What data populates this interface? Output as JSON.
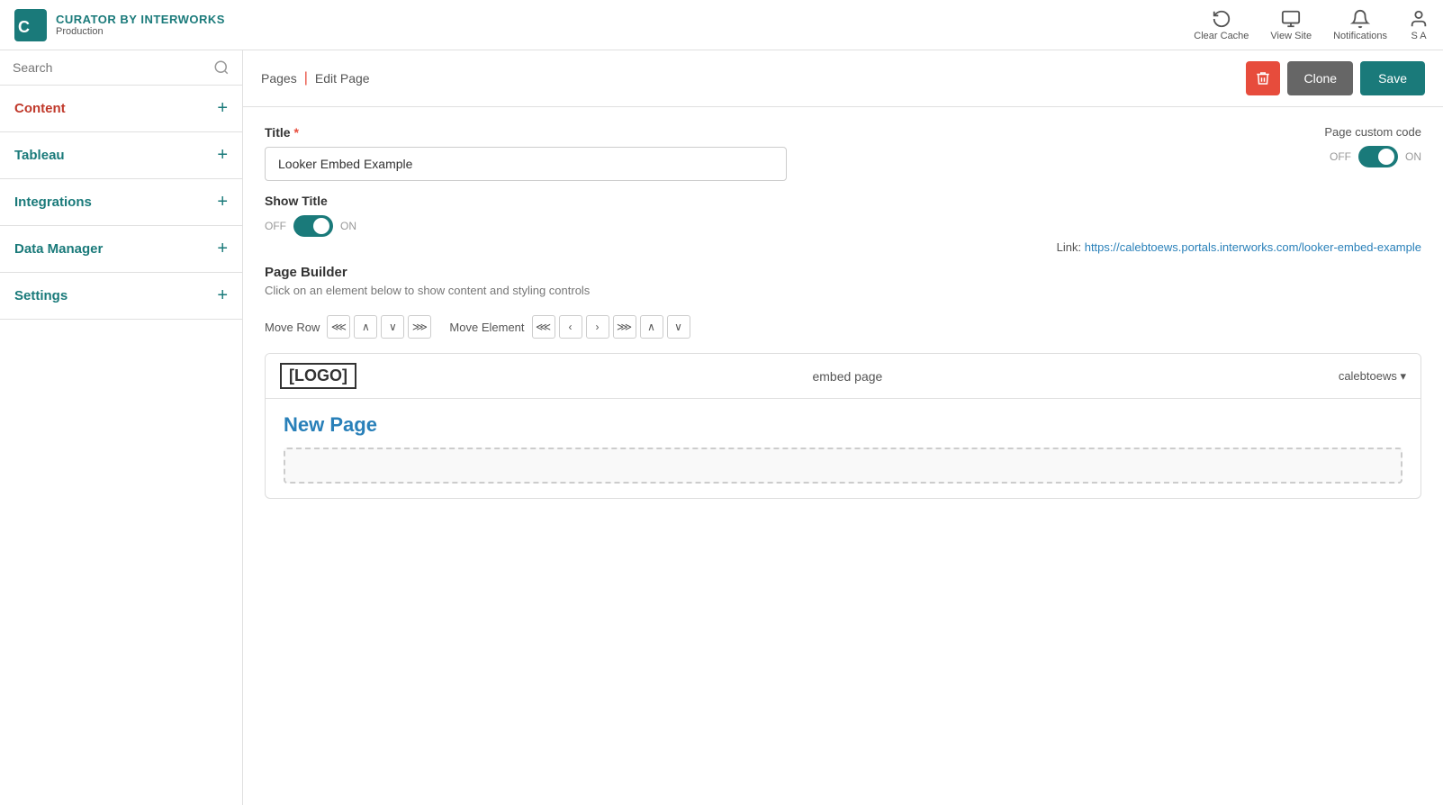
{
  "app": {
    "brand": "CURATOR",
    "brand_sub": "BY INTERWORKS",
    "product": "Curator by InterWorks",
    "env": "Production"
  },
  "header_actions": [
    {
      "id": "clear-cache",
      "label": "Clear Cache",
      "icon": "history-icon"
    },
    {
      "id": "view-site",
      "label": "View Site",
      "icon": "monitor-icon"
    },
    {
      "id": "notifications",
      "label": "Notifications",
      "icon": "bell-icon"
    },
    {
      "id": "user",
      "label": "S A",
      "icon": "user-icon"
    }
  ],
  "search": {
    "placeholder": "Search"
  },
  "sidebar": {
    "items": [
      {
        "id": "content",
        "label": "Content",
        "color": "red"
      },
      {
        "id": "tableau",
        "label": "Tableau",
        "color": "teal"
      },
      {
        "id": "integrations",
        "label": "Integrations",
        "color": "teal"
      },
      {
        "id": "data-manager",
        "label": "Data Manager",
        "color": "teal"
      },
      {
        "id": "settings",
        "label": "Settings",
        "color": "teal"
      }
    ]
  },
  "page_header": {
    "breadcrumb_pages": "Pages",
    "breadcrumb_current": "Edit Page",
    "btn_delete_label": "",
    "btn_clone_label": "Clone",
    "btn_save_label": "Save"
  },
  "edit_page": {
    "title_label": "Title",
    "title_required": true,
    "title_value": "Looker Embed Example",
    "show_title_label": "Show Title",
    "show_title_on": true,
    "toggle_off": "OFF",
    "toggle_on": "ON",
    "custom_code_label": "Page custom code",
    "custom_code_off": "OFF",
    "custom_code_on": "ON",
    "custom_code_enabled": true,
    "link_label": "Link:",
    "link_url": "https://calebtoews.portals.interworks.com/looker-embed-example"
  },
  "page_builder": {
    "title": "Page Builder",
    "hint": "Click on an element below to show content and styling controls",
    "move_row_label": "Move Row",
    "move_element_label": "Move Element",
    "preview": {
      "logo": "[LOGO]",
      "nav_item": "embed page",
      "user_menu": "calebtoews ▾",
      "new_page_text": "New Page"
    }
  }
}
